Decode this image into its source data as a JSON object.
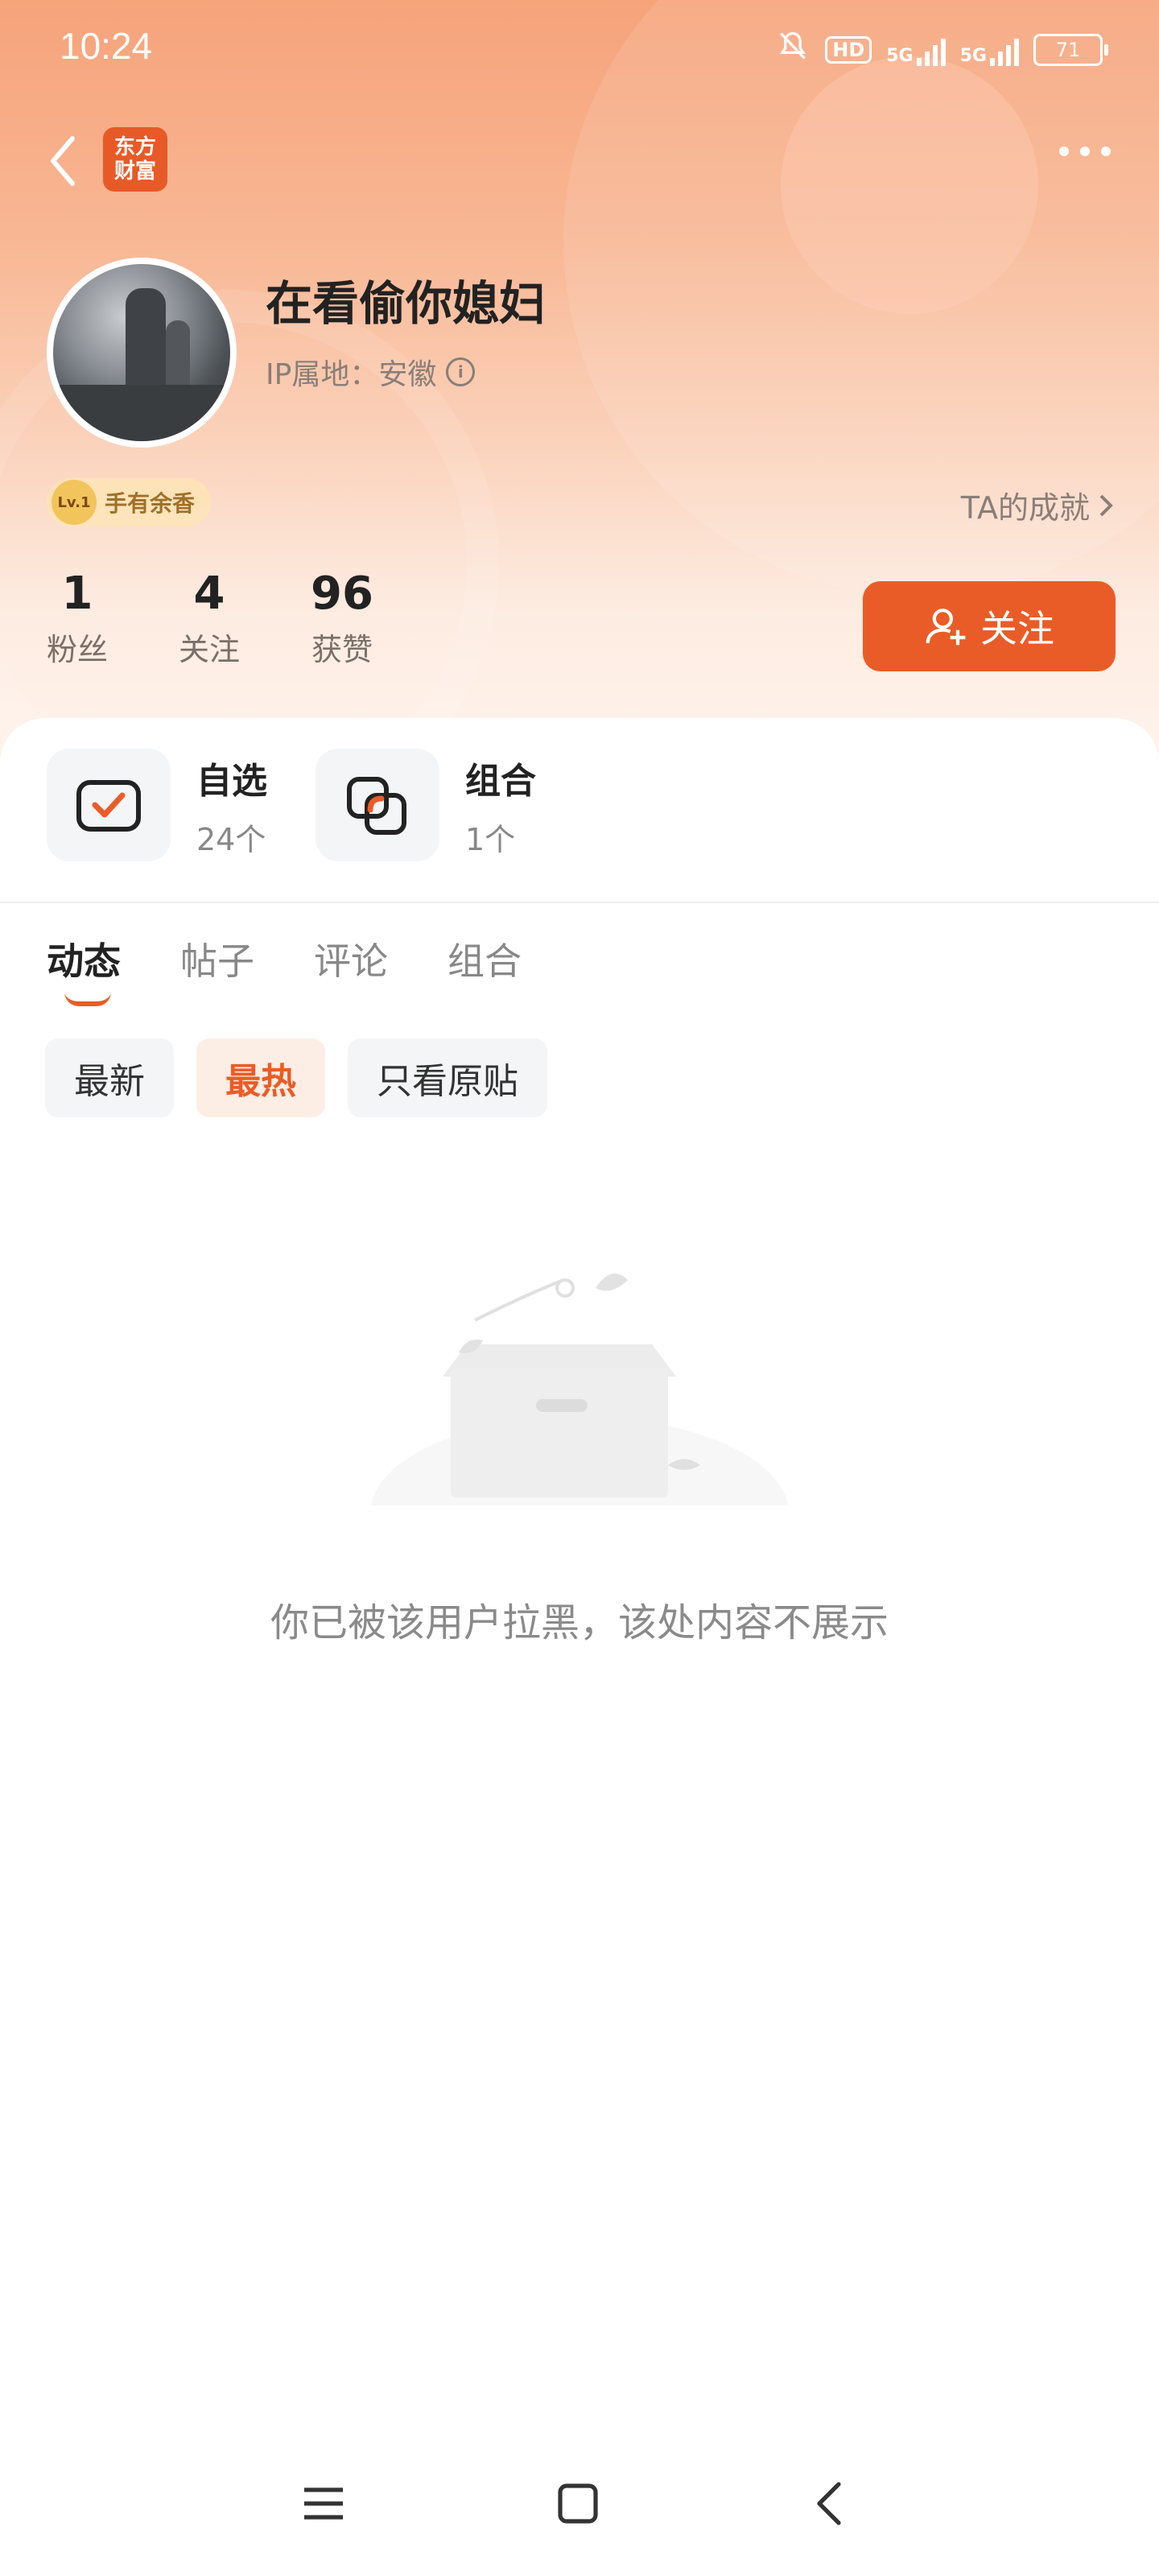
{
  "status_bar": {
    "time": "10:24",
    "hd": "HD",
    "net1": "5G",
    "net2": "5G",
    "battery": "71"
  },
  "header": {
    "logo_line1": "东方",
    "logo_line2": "财富"
  },
  "profile": {
    "name": "在看偷你媳妇",
    "ip_location": "IP属地：安徽",
    "badge_level": "Lv.1",
    "badge_text": "手有余香",
    "achievements_label": "TA的成就"
  },
  "stats": [
    {
      "number": "1",
      "label": "粉丝"
    },
    {
      "number": "4",
      "label": "关注"
    },
    {
      "number": "96",
      "label": "获赞"
    }
  ],
  "follow_button": "关注",
  "shortcuts": [
    {
      "title": "自选",
      "count": "24个"
    },
    {
      "title": "组合",
      "count": "1个"
    }
  ],
  "tabs": [
    "动态",
    "帖子",
    "评论",
    "组合"
  ],
  "filters": [
    "最新",
    "最热",
    "只看原贴"
  ],
  "empty_message": "你已被该用户拉黑，该处内容不展示",
  "colors": {
    "accent": "#ea5c27",
    "hero_top": "#f6a37a"
  }
}
